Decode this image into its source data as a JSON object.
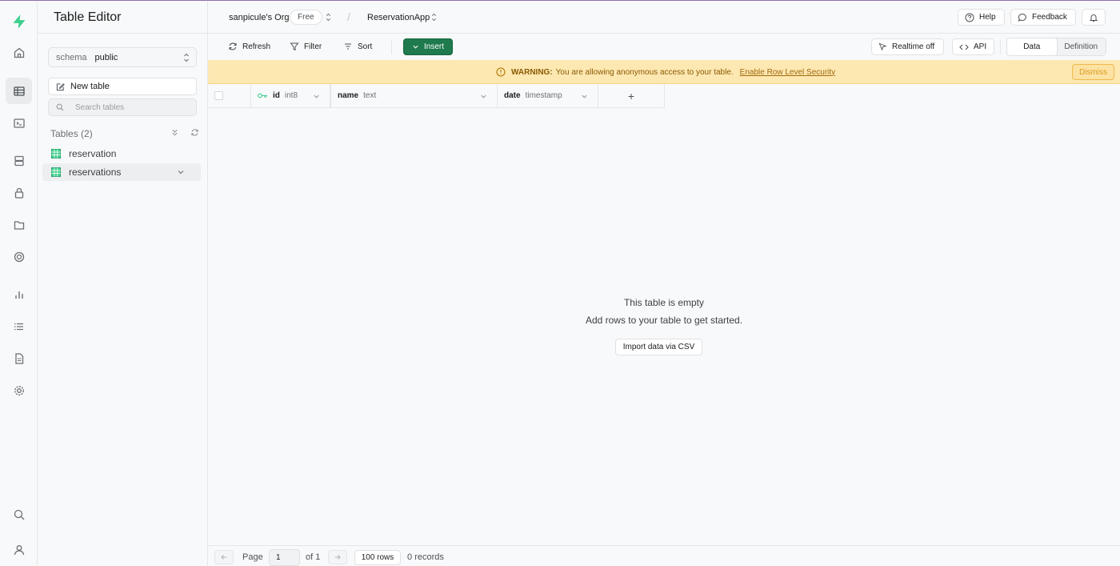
{
  "app": {
    "title": "Table Editor"
  },
  "rail": {
    "items": [
      "home-icon",
      "table-editor-icon",
      "sql-editor-icon",
      "database-icon",
      "auth-icon",
      "storage-icon",
      "edge-functions-icon",
      "reports-icon",
      "logs-icon",
      "api-docs-icon",
      "settings-icon",
      "search-icon",
      "user-icon"
    ]
  },
  "sidebar": {
    "schema_label": "schema",
    "schema_value": "public",
    "new_table_label": "New table",
    "search_placeholder": "Search tables",
    "tables_heading": "Tables (2)",
    "tables": [
      {
        "name": "reservation",
        "selected": false
      },
      {
        "name": "reservations",
        "selected": true
      }
    ]
  },
  "header": {
    "org": "sanpicule's Org",
    "plan_badge": "Free",
    "separator": "/",
    "project": "ReservationApp",
    "help_label": "Help",
    "feedback_label": "Feedback"
  },
  "toolbar": {
    "refresh_label": "Refresh",
    "filter_label": "Filter",
    "sort_label": "Sort",
    "insert_label": "Insert",
    "realtime_label": "Realtime off",
    "api_label": "API",
    "view_tabs": [
      "Data",
      "Definition"
    ],
    "active_view": "Data"
  },
  "warning": {
    "title": "WARNING:",
    "message": "You are allowing anonymous access to your table.",
    "link": "Enable Row Level Security",
    "dismiss_label": "Dismiss"
  },
  "grid": {
    "columns": [
      {
        "name": "id",
        "type": "int8",
        "primary_key": true
      },
      {
        "name": "name",
        "type": "text",
        "primary_key": false
      },
      {
        "name": "date",
        "type": "timestamp",
        "primary_key": false
      }
    ],
    "add_column_label": "+"
  },
  "empty_state": {
    "title": "This table is empty",
    "subtitle": "Add rows to your table to get started.",
    "import_label": "Import data via CSV"
  },
  "footer": {
    "page_label": "Page",
    "page_value": "1",
    "of_label": "of 1",
    "rows_label": "100 rows",
    "records_label": "0 records"
  },
  "colors": {
    "brand_green": "#3ecf8e",
    "insert_green": "#1f7a4e",
    "warning_bg": "#fde8b2"
  }
}
